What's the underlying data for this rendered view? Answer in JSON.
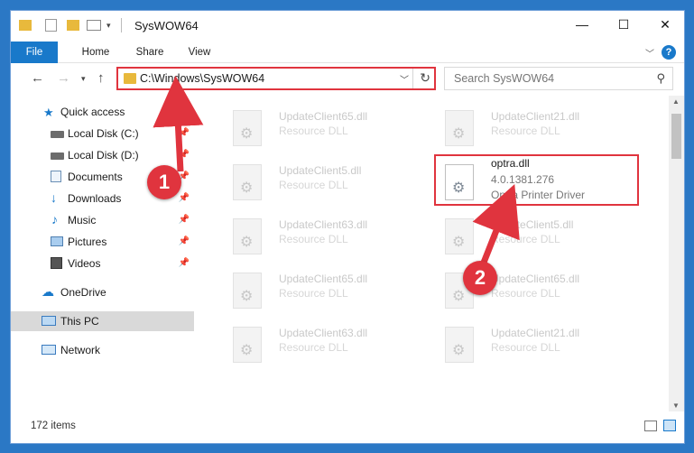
{
  "titlebar": {
    "title": "SysWOW64",
    "minimize": "—",
    "maximize": "☐",
    "close": "✕"
  },
  "ribbon": {
    "tabs": [
      "File",
      "Home",
      "Share",
      "View"
    ],
    "help": "?"
  },
  "navbar": {
    "address": "C:\\Windows\\SysWOW64",
    "search_placeholder": "Search SysWOW64"
  },
  "sidebar": {
    "items": [
      {
        "label": "Quick access",
        "icon": "star-icon",
        "pinned": false
      },
      {
        "label": "Local Disk (C:)",
        "icon": "drive-icon",
        "pinned": true
      },
      {
        "label": "Local Disk (D:)",
        "icon": "drive-icon",
        "pinned": true
      },
      {
        "label": "Documents",
        "icon": "documents-icon",
        "pinned": true
      },
      {
        "label": "Downloads",
        "icon": "download-icon",
        "pinned": true
      },
      {
        "label": "Music",
        "icon": "music-icon",
        "pinned": true
      },
      {
        "label": "Pictures",
        "icon": "pictures-icon",
        "pinned": true
      },
      {
        "label": "Videos",
        "icon": "videos-icon",
        "pinned": true
      },
      {
        "label": "OneDrive",
        "icon": "cloud-icon",
        "pinned": false
      },
      {
        "label": "This PC",
        "icon": "computer-icon",
        "pinned": false,
        "selected": true
      },
      {
        "label": "Network",
        "icon": "network-icon",
        "pinned": false
      }
    ]
  },
  "files": [
    {
      "name": "UpdateClient65.dll",
      "type": "Resource DLL"
    },
    {
      "name": "UpdateClient21.dll",
      "type": "Resource DLL"
    },
    {
      "name": "UpdateClient5.dll",
      "type": "Resource DLL"
    },
    {
      "name": "optra.dll",
      "version": "4.0.1381.276",
      "type": "Optra Printer Driver"
    },
    {
      "name": "UpdateClient63.dll",
      "type": "Resource DLL"
    },
    {
      "name": "UpdateClient5.dll",
      "type": "Resource DLL"
    },
    {
      "name": "UpdateClient65.dll",
      "type": "Resource DLL"
    },
    {
      "name": "UpdateClient65.dll",
      "type": "Resource DLL"
    },
    {
      "name": "UpdateClient63.dll",
      "type": "Resource DLL"
    },
    {
      "name": "UpdateClient21.dll",
      "type": "Resource DLL"
    }
  ],
  "status": {
    "item_count": "172 items"
  },
  "annotations": {
    "step1": "1",
    "step2": "2",
    "accent_color": "#e0343e"
  }
}
